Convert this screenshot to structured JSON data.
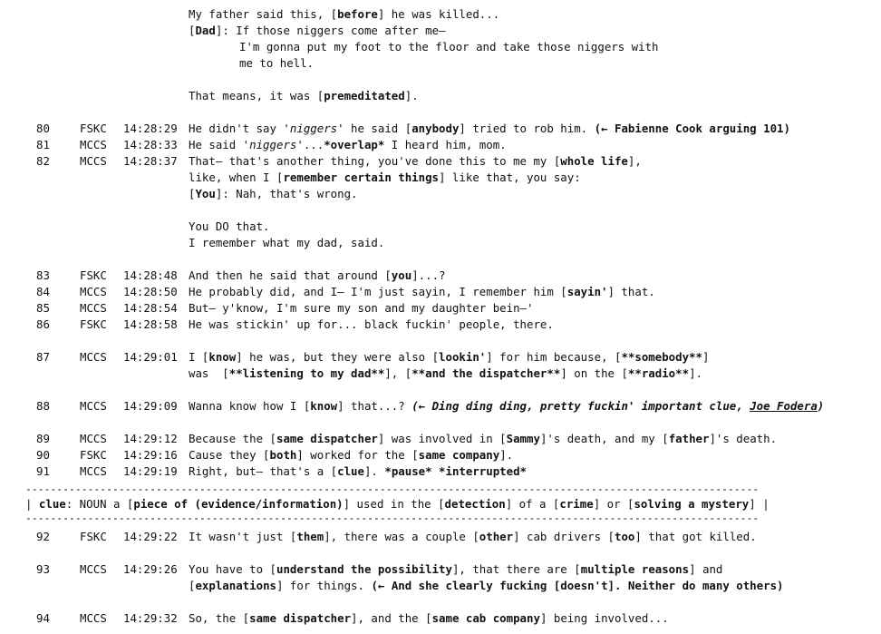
{
  "intro": [
    "My father said this, [<b>before</b>] he was killed...",
    "[<b>Dad</b>]: If those niggers come after me–",
    "I'm gonna put my foot to the floor and take those niggers with",
    "me to hell.",
    "That means, it was [<b>premeditated</b>]."
  ],
  "rows": [
    {
      "num": "80",
      "who": "FSKC",
      "time": "14:28:29",
      "lines": [
        "He didn't say '<i>niggers</i>' he said [<b>anybody</b>] tried to rob him. <b>(← Fabienne Cook arguing 101)</b>"
      ]
    },
    {
      "num": "81",
      "who": "MCCS",
      "time": "14:28:33",
      "lines": [
        "He said '<i>niggers</i>'...<b>*overlap*</b> I heard him, mom."
      ]
    },
    {
      "num": "82",
      "who": "MCCS",
      "time": "14:28:37",
      "lines": [
        "That– that's another thing, you've done this to me my [<b>whole life</b>],",
        "like, when I [<b>remember certain things</b>] like that, you say:",
        "[<b>You</b>]: Nah, that's wrong.",
        "",
        "You DO that.",
        "I remember what my dad, said."
      ]
    },
    {
      "num": "83",
      "who": "FSKC",
      "time": "14:28:48",
      "lines": [
        "And then he said that around [<b>you</b>]...?"
      ]
    },
    {
      "num": "84",
      "who": "MCCS",
      "time": "14:28:50",
      "lines": [
        "He probably did, and I– I'm just sayin, I remember him [<b>sayin'</b>] that."
      ]
    },
    {
      "num": "85",
      "who": "MCCS",
      "time": "14:28:54",
      "lines": [
        "But– y'know, I'm sure my son and my daughter bein–'"
      ]
    },
    {
      "num": "86",
      "who": "FSKC",
      "time": "14:28:58",
      "lines": [
        "He was stickin' up for... black fuckin' people, there."
      ]
    },
    {
      "num": "87",
      "who": "MCCS",
      "time": "14:29:01",
      "lines": [
        "I [<b>know</b>] he was, but they were also [<b>lookin'</b>] for him because, [<b>**somebody**</b>]",
        "was  [<b>**listening to my dad**</b>], [<b>**and the dispatcher**</b>] on the [<b>**radio**</b>]."
      ]
    },
    {
      "num": "88",
      "who": "MCCS",
      "time": "14:29:09",
      "lines": [
        "Wanna know how I [<b>know</b>] that...? <b><i>(← Ding ding ding, pretty fuckin' important clue, <u>Joe Fodera</u>)</i></b>"
      ]
    },
    {
      "num": "89",
      "who": "MCCS",
      "time": "14:29:12",
      "lines": [
        "Because the [<b>same dispatcher</b>] was involved in [<b>Sammy</b>]'s death, and my [<b>father</b>]'s death."
      ]
    },
    {
      "num": "90",
      "who": "FSKC",
      "time": "14:29:16",
      "lines": [
        "Cause they [<b>both</b>] worked for the [<b>same company</b>]."
      ]
    },
    {
      "num": "91",
      "who": "MCCS",
      "time": "14:29:19",
      "lines": [
        "Right, but– that's a [<b>clue</b>]. <b>*pause* *interrupted*</b>"
      ]
    },
    {
      "num": "92",
      "who": "FSKC",
      "time": "14:29:22",
      "lines": [
        "It wasn't just [<b>them</b>], there was a couple [<b>other</b>] cab drivers [<b>too</b>] that got killed."
      ]
    },
    {
      "num": "93",
      "who": "MCCS",
      "time": "14:29:26",
      "lines": [
        "You have to [<b>understand the possibility</b>], that there are [<b>multiple reasons</b>] and",
        "[<b>explanations</b>] for things. <b>(← And she clearly fucking [doesn't]. Neither do many others)</b>"
      ]
    },
    {
      "num": "94",
      "who": "MCCS",
      "time": "14:29:32",
      "lines": [
        "So, the [<b>same dispatcher</b>], and the [<b>same cab company</b>] being involved..."
      ]
    }
  ],
  "definition": {
    "rule": "----------------------------------------------------------------------------------------------------------------------",
    "text": "| <b>clue</b>: NOUN a [<b>piece of (evidence/information)</b>] used in the [<b>detection</b>] of a [<b>crime</b>] or [<b>solving a mystery</b>] |"
  }
}
